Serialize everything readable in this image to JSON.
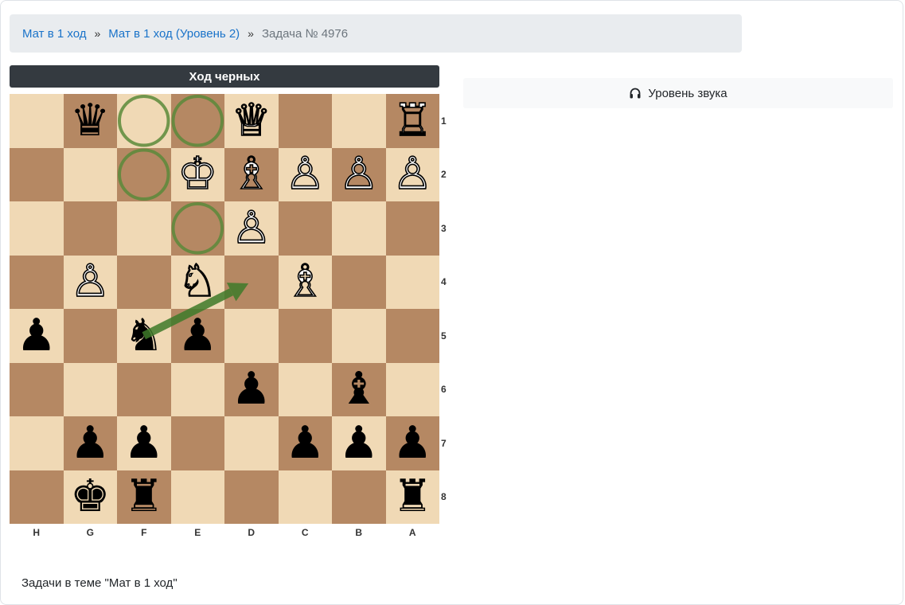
{
  "breadcrumb": {
    "items": [
      "Мат в 1 ход",
      "Мат в 1 ход (Уровень 2)"
    ],
    "separator": "»",
    "current": "Задача № 4976"
  },
  "turn_label": "Ход черных",
  "sound_button_label": "Уровень звука",
  "topic_title": "Задачи в теме \"Мат в 1 ход\"",
  "board": {
    "files": [
      "H",
      "G",
      "F",
      "E",
      "D",
      "C",
      "B",
      "A"
    ],
    "ranks": [
      "1",
      "2",
      "3",
      "4",
      "5",
      "6",
      "7",
      "8"
    ],
    "colors": {
      "light": "#f0d9b5",
      "dark": "#b58863",
      "highlight": "#5b8a3a"
    },
    "pieces": [
      {
        "square": "g1",
        "piece": "queen",
        "color": "black"
      },
      {
        "square": "d1",
        "piece": "queen",
        "color": "white"
      },
      {
        "square": "a1",
        "piece": "rook",
        "color": "white"
      },
      {
        "square": "e2",
        "piece": "king",
        "color": "white"
      },
      {
        "square": "d2",
        "piece": "bishop",
        "color": "white"
      },
      {
        "square": "c2",
        "piece": "pawn",
        "color": "white"
      },
      {
        "square": "b2",
        "piece": "pawn",
        "color": "white"
      },
      {
        "square": "a2",
        "piece": "pawn",
        "color": "white"
      },
      {
        "square": "d3",
        "piece": "pawn",
        "color": "white"
      },
      {
        "square": "g4",
        "piece": "pawn",
        "color": "white"
      },
      {
        "square": "e4",
        "piece": "knight",
        "color": "white"
      },
      {
        "square": "c4",
        "piece": "bishop",
        "color": "white"
      },
      {
        "square": "h5",
        "piece": "pawn",
        "color": "black"
      },
      {
        "square": "f5",
        "piece": "knight",
        "color": "black"
      },
      {
        "square": "e5",
        "piece": "pawn",
        "color": "black"
      },
      {
        "square": "d6",
        "piece": "pawn",
        "color": "black"
      },
      {
        "square": "b6",
        "piece": "bishop",
        "color": "black"
      },
      {
        "square": "g7",
        "piece": "pawn",
        "color": "black"
      },
      {
        "square": "f7",
        "piece": "pawn",
        "color": "black"
      },
      {
        "square": "c7",
        "piece": "pawn",
        "color": "black"
      },
      {
        "square": "b7",
        "piece": "pawn",
        "color": "black"
      },
      {
        "square": "a7",
        "piece": "pawn",
        "color": "black"
      },
      {
        "square": "g8",
        "piece": "king",
        "color": "black"
      },
      {
        "square": "f8",
        "piece": "rook",
        "color": "black"
      },
      {
        "square": "a8",
        "piece": "rook",
        "color": "black"
      }
    ],
    "highlight_circles": [
      "f1",
      "e1",
      "f2",
      "e3"
    ],
    "arrow": {
      "from": "f5",
      "to": "d4"
    }
  }
}
